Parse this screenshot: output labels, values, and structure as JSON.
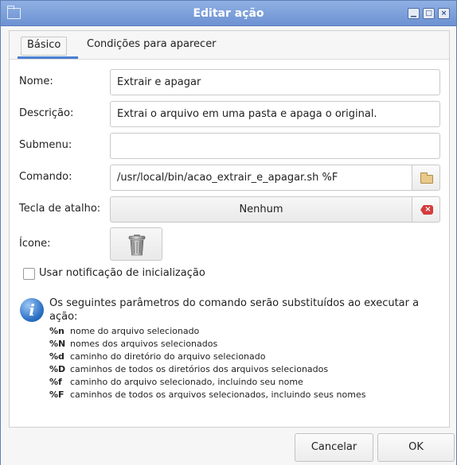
{
  "window": {
    "title": "Editar ação",
    "controls": {
      "minimize": "▁",
      "maximize": "□",
      "close": "×"
    }
  },
  "tabs": [
    {
      "label": "Básico",
      "active": true
    },
    {
      "label": "Condições para aparecer",
      "active": false
    }
  ],
  "form": {
    "name_label": "Nome:",
    "name_value": "Extrair e apagar",
    "description_label": "Descrição:",
    "description_value": "Extrai o arquivo em uma pasta e apaga o original.",
    "submenu_label": "Submenu:",
    "submenu_value": "",
    "command_label": "Comando:",
    "command_value": "/usr/local/bin/acao_extrair_e_apagar.sh %F",
    "shortcut_label": "Tecla de atalho:",
    "shortcut_value": "Nenhum",
    "icon_label": "Ícone:",
    "startup_notification_label": "Usar notificação de inicialização",
    "startup_notification_checked": false
  },
  "info": {
    "text": "Os seguintes parâmetros do comando serão substituídos ao executar a ação:",
    "params": [
      {
        "code": "%n",
        "desc": "nome do arquivo selecionado"
      },
      {
        "code": "%N",
        "desc": "nomes dos arquivos selecionados"
      },
      {
        "code": "%d",
        "desc": "caminho do diretório do arquivo selecionado"
      },
      {
        "code": "%D",
        "desc": "caminhos de todos os diretórios dos arquivos selecionados"
      },
      {
        "code": "%f",
        "desc": "caminho do arquivo selecionado, incluindo seu nome"
      },
      {
        "code": "%F",
        "desc": "caminhos de todos os arquivos selecionados, incluindo seus nomes"
      }
    ]
  },
  "footer": {
    "cancel_label": "Cancelar",
    "ok_label": "OK"
  },
  "colors": {
    "titlebar": "#7a9ddb",
    "tab_accent": "#4a7fd1",
    "clear_icon": "#d43c3c",
    "info_icon": "#2a6fc4"
  },
  "icons": {
    "title": "folder-icon",
    "command_browse": "folder-icon",
    "shortcut_clear": "clear-icon",
    "action_icon": "trash-icon",
    "info": "info-icon"
  }
}
